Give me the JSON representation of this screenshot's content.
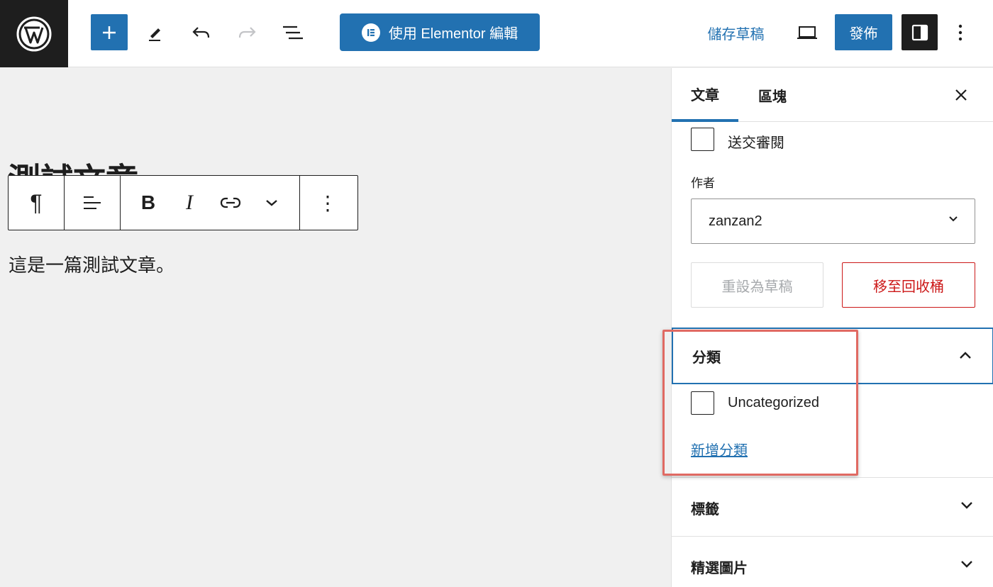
{
  "header": {
    "elementor_button_label": "使用 Elementor 編輯",
    "save_draft_label": "儲存草稿",
    "publish_label": "發佈"
  },
  "editor": {
    "post_title": "測試文章",
    "paragraph_text": "這是一篇測試文章。",
    "block_toolbar": {
      "paragraph_glyph": "¶",
      "bold_label": "B",
      "italic_label": "I",
      "more_glyph": "⋮"
    }
  },
  "sidebar": {
    "tabs": [
      {
        "label": "文章",
        "active": true
      },
      {
        "label": "區塊",
        "active": false
      }
    ],
    "pending_review_label": "送交審閱",
    "author_label": "作者",
    "author_value": "zanzan2",
    "reset_draft_label": "重設為草稿",
    "move_to_trash_label": "移至回收桶",
    "categories": {
      "title": "分類",
      "expanded": true,
      "items": [
        {
          "label": "Uncategorized",
          "checked": false
        }
      ],
      "add_new_label": "新增分類"
    },
    "tags_title": "標籤",
    "featured_image_title": "精選圖片"
  },
  "colors": {
    "accent": "#2271b1",
    "danger": "#cc1818",
    "highlight": "#e06a63",
    "dark": "#1e1e1e"
  },
  "icons": [
    "wordpress-logo-icon",
    "plus-icon",
    "pencil-icon",
    "undo-icon",
    "redo-icon",
    "list-view-icon",
    "elementor-icon",
    "desktop-preview-icon",
    "sidebar-toggle-icon",
    "more-vertical-icon",
    "close-icon",
    "chevron-down-icon",
    "chevron-up-icon",
    "align-icon",
    "link-icon"
  ]
}
